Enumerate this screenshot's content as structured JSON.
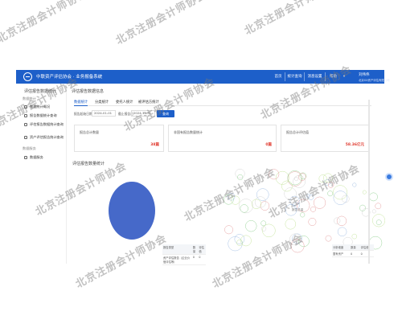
{
  "header": {
    "app_title": "中联资产评估协会 · 业务报备系统",
    "nav": [
      "首页",
      "统计查询",
      "消息设置",
      "帮助"
    ],
    "user_name": "刘伟伟",
    "user_org": "北京XX资产评估有限公司",
    "brand_color": "#1d5fc9"
  },
  "sidebar": {
    "title": "评估报告数据统计",
    "groups": [
      {
        "label": "数据统计",
        "items": [
          "数据统计概况",
          "报告数据统计查询",
          "评估报告数据统计查询",
          "资产评估报告统计查询"
        ]
      },
      {
        "label": "数据服务",
        "items": [
          "数据服务"
        ]
      }
    ]
  },
  "main": {
    "title": "评估报告数据信息",
    "tabs": [
      "数据统计",
      "分类统计",
      "委托人统计",
      "被评估方统计"
    ],
    "filters": {
      "start_label": "报告起始日期",
      "start_value": "2024-01-01",
      "end_label": "截止报告日",
      "end_value": "2024-12-31",
      "search_label": "查询"
    },
    "cards": [
      {
        "label": "报告总计数量",
        "value": "38篇"
      },
      {
        "label": "非国有报告数量统计",
        "value": "0篇"
      },
      {
        "label": "报告总计评估值",
        "value": "58.36亿元"
      }
    ],
    "section_title": "评估报告数量统计"
  },
  "left_table": {
    "headers": [
      "报告类型",
      "数量",
      "评估值"
    ],
    "rows": [
      [
        "资产评估报告（企业价值评估等）",
        "0",
        "0"
      ]
    ]
  },
  "scatter_label": "报告总量",
  "right_table": {
    "headers": [
      "分析维度",
      "数量",
      "评估值"
    ],
    "rows": [
      [
        "国有资产",
        "0",
        "0"
      ]
    ]
  },
  "watermark": "北京注册会计师协会",
  "accent_color": "#e03a2f",
  "pie_color": "#4669c9"
}
